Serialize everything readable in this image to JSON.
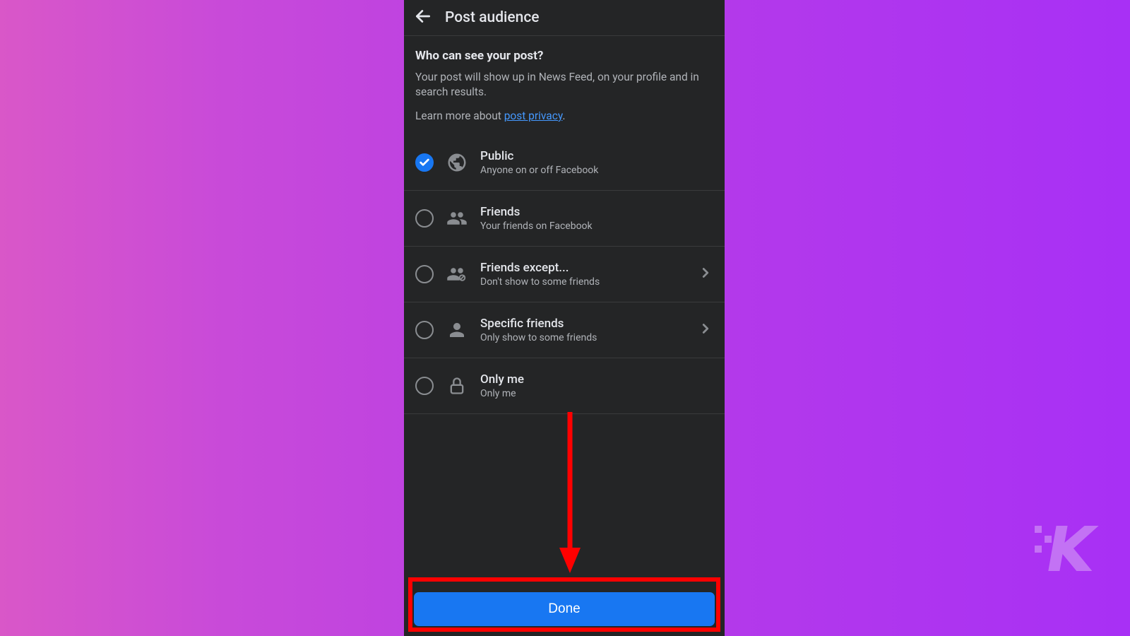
{
  "header": {
    "title": "Post audience"
  },
  "content": {
    "section_title": "Who can see your post?",
    "description": "Your post will show up in News Feed, on your profile and in search results.",
    "learn_more_prefix": "Learn more about ",
    "privacy_link_text": "post privacy",
    "learn_more_suffix": "."
  },
  "options": [
    {
      "id": "public",
      "title": "Public",
      "subtitle": "Anyone on or off Facebook",
      "selected": true,
      "has_chevron": false
    },
    {
      "id": "friends",
      "title": "Friends",
      "subtitle": "Your friends on Facebook",
      "selected": false,
      "has_chevron": false
    },
    {
      "id": "friends-except",
      "title": "Friends except...",
      "subtitle": "Don't show to some friends",
      "selected": false,
      "has_chevron": true
    },
    {
      "id": "specific-friends",
      "title": "Specific friends",
      "subtitle": "Only show to some friends",
      "selected": false,
      "has_chevron": true
    },
    {
      "id": "only-me",
      "title": "Only me",
      "subtitle": "Only me",
      "selected": false,
      "has_chevron": false
    }
  ],
  "footer": {
    "done_label": "Done"
  },
  "colors": {
    "accent_blue": "#1877f2",
    "link_blue": "#4599ff",
    "dark_bg": "#242526",
    "highlight_red": "#ff0000"
  }
}
